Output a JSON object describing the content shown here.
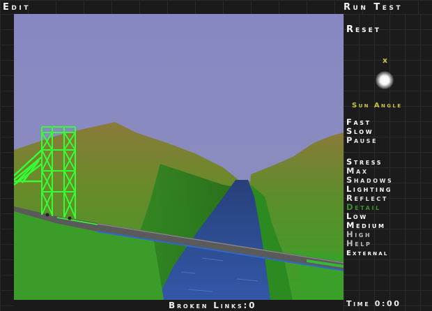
{
  "menu": {
    "edit": "Edit",
    "run_test": "Run Test"
  },
  "sidebar": {
    "reset": "Reset",
    "sun_marker": "x",
    "sun_angle": "Sun Angle",
    "fast": "Fast",
    "slow": "Slow",
    "pause": "Pause",
    "stress": "Stress",
    "max": "Max",
    "shadows": "Shadows",
    "lighting": "Lighting",
    "reflect": "Reflect",
    "detail": "Detail",
    "low": "Low",
    "medium": "Medium",
    "high": "High",
    "help": "Help",
    "external": "External"
  },
  "status": {
    "broken_links": "Broken Links:0",
    "time": "Time 0:00"
  },
  "colors": {
    "sky": "#8a8cc0",
    "grass": "#3d9b2a",
    "water": "#2e4f93",
    "tower": "#33ff33",
    "detail_active": "#3f8f2e",
    "sun_angle": "#c9c73a"
  }
}
